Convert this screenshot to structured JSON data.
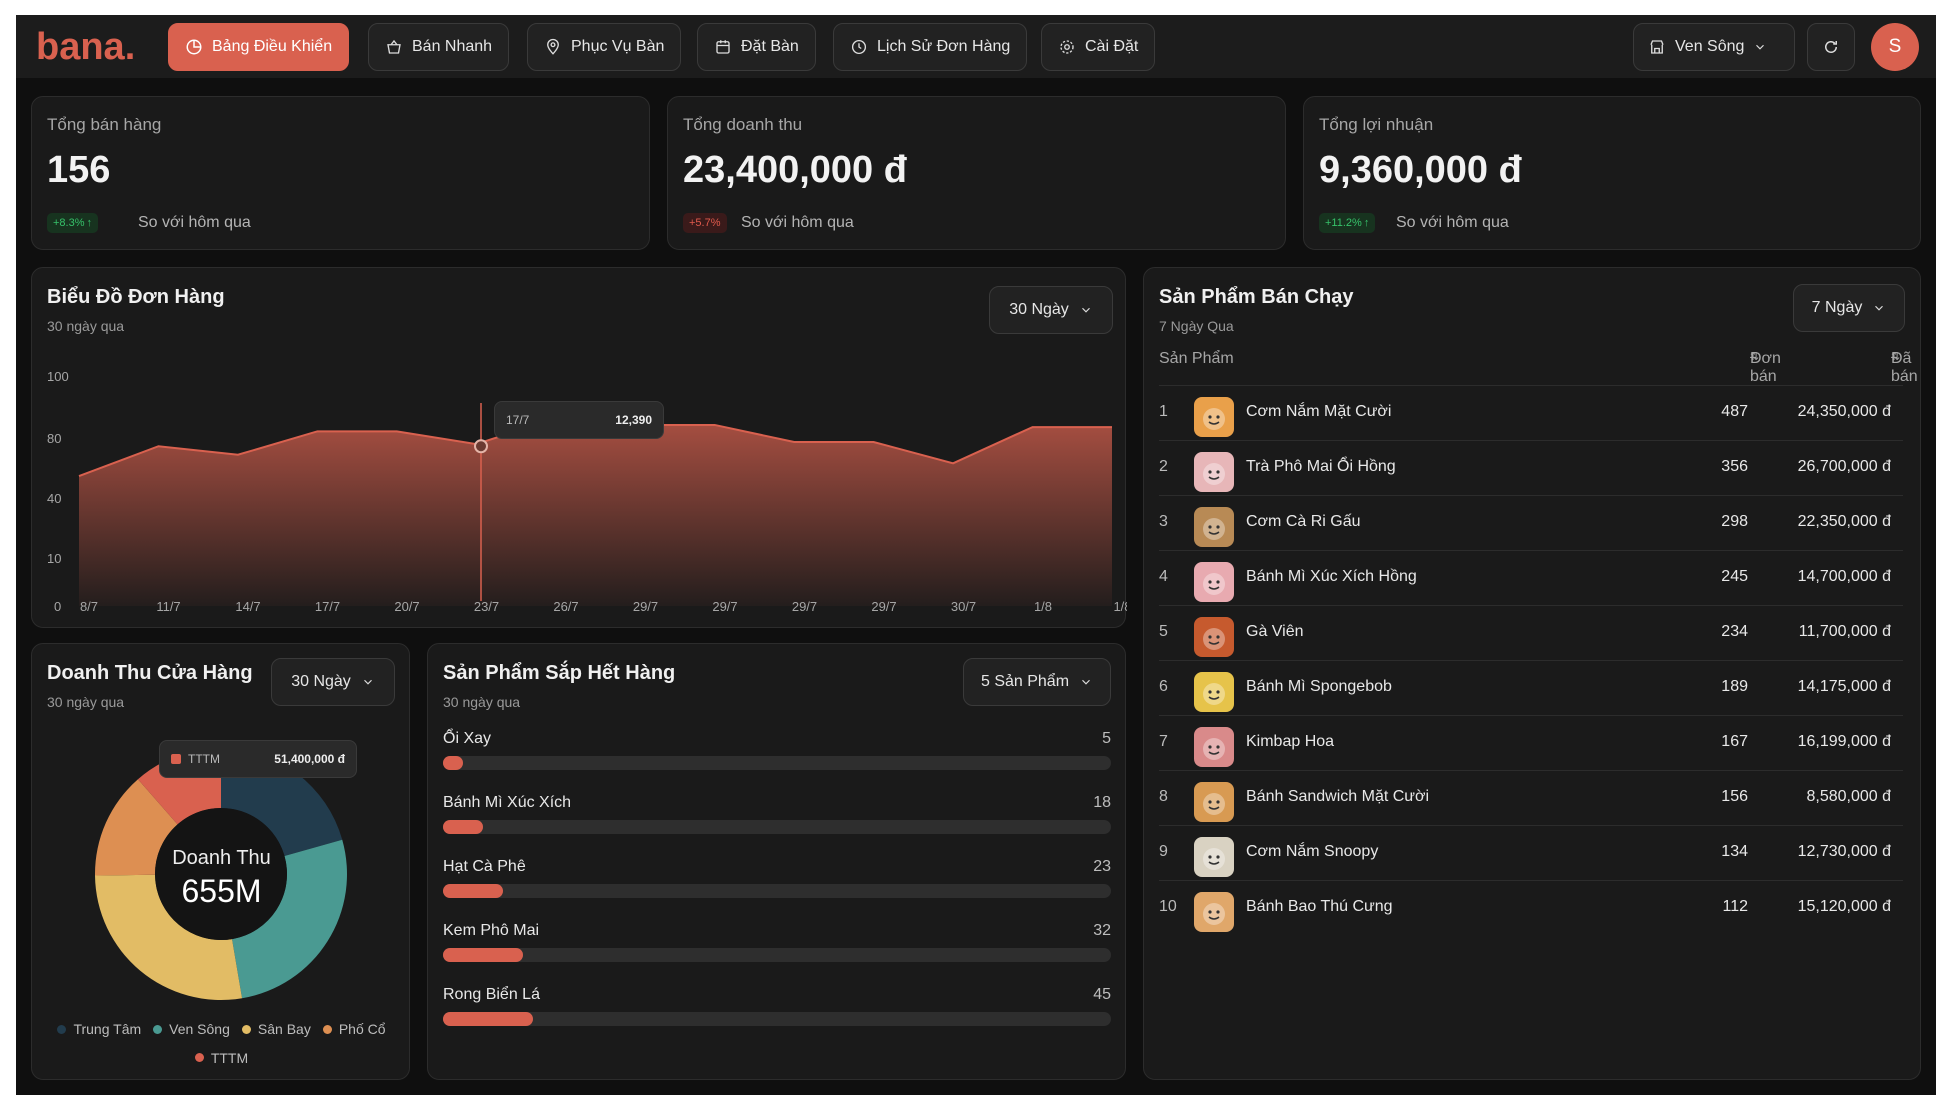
{
  "brand": {
    "logo_text": "bana."
  },
  "nav": {
    "items": [
      {
        "label": "Bảng Điều Khiển",
        "icon": "dashboard-icon",
        "active": true
      },
      {
        "label": "Bán Nhanh",
        "icon": "basket-icon",
        "active": false
      },
      {
        "label": "Phục Vụ Bàn",
        "icon": "location-icon",
        "active": false
      },
      {
        "label": "Đặt Bàn",
        "icon": "calendar-icon",
        "active": false
      },
      {
        "label": "Lịch Sử Đơn Hàng",
        "icon": "history-icon",
        "active": false
      },
      {
        "label": "Cài Đặt",
        "icon": "gear-icon",
        "active": false
      }
    ],
    "store": "Ven Sông",
    "avatar_initial": "S"
  },
  "kpis": [
    {
      "title": "Tổng bán hàng",
      "value": "156",
      "change": "+8.3%",
      "direction": "up",
      "compare": "So với hôm qua"
    },
    {
      "title": "Tổng doanh thu",
      "value": "23,400,000 đ",
      "change": "+5.7%",
      "direction": "down",
      "compare": "So với hôm qua"
    },
    {
      "title": "Tổng lợi nhuận",
      "value": "9,360,000 đ",
      "change": "+11.2%",
      "direction": "up",
      "compare": "So với hôm qua"
    }
  ],
  "orders_chart": {
    "title": "Biểu Đồ Đơn Hàng",
    "subtitle": "30 ngày qua",
    "range": "30 Ngày",
    "tooltip": {
      "date": "17/7",
      "value": "12,390"
    }
  },
  "revenue": {
    "title": "Doanh Thu Cửa Hàng",
    "subtitle": "30 ngày qua",
    "range": "30 Ngày",
    "center_label": "Doanh Thu",
    "center_value": "655M",
    "tooltip": {
      "name": "TTTM",
      "value": "51,400,000 đ"
    }
  },
  "low_stock": {
    "title": "Sản Phẩm Sắp Hết Hàng",
    "subtitle": "30 ngày qua",
    "range": "5 Sản Phẩm",
    "items": [
      {
        "name": "Ổi Xay",
        "qty": "5",
        "fraction": 0.03
      },
      {
        "name": "Bánh Mì Xúc Xích",
        "qty": "18",
        "fraction": 0.06
      },
      {
        "name": "Hạt Cà Phê",
        "qty": "23",
        "fraction": 0.09
      },
      {
        "name": "Kem Phô Mai",
        "qty": "32",
        "fraction": 0.12
      },
      {
        "name": "Rong Biển Lá",
        "qty": "45",
        "fraction": 0.135
      }
    ]
  },
  "best_sellers": {
    "title": "Sản Phẩm Bán Chạy",
    "subtitle": "7 Ngày Qua",
    "range": "7 Ngày",
    "columns": {
      "product": "Sản Phẩm",
      "orders": "Đơn bán",
      "sold": "Đã bán"
    },
    "rows": [
      {
        "rank": "1",
        "name": "Cơm Nắm Mặt Cười",
        "orders": "487",
        "sold": "24,350,000 đ",
        "color": "#e9a04a"
      },
      {
        "rank": "2",
        "name": "Trà Phô Mai Ổi Hồng",
        "orders": "356",
        "sold": "26,700,000 đ",
        "color": "#e7b6b8"
      },
      {
        "rank": "3",
        "name": "Cơm Cà Ri Gấu",
        "orders": "298",
        "sold": "22,350,000 đ",
        "color": "#b88a55"
      },
      {
        "rank": "4",
        "name": "Bánh Mì Xúc Xích Hồng",
        "orders": "245",
        "sold": "14,700,000 đ",
        "color": "#e8aab0"
      },
      {
        "rank": "5",
        "name": "Gà Viên",
        "orders": "234",
        "sold": "11,700,000 đ",
        "color": "#c65a2e"
      },
      {
        "rank": "6",
        "name": "Bánh Mì Spongebob",
        "orders": "189",
        "sold": "14,175,000 đ",
        "color": "#e6c34a"
      },
      {
        "rank": "7",
        "name": "Kimbap Hoa",
        "orders": "167",
        "sold": "16,199,000 đ",
        "color": "#d98a8a"
      },
      {
        "rank": "8",
        "name": "Bánh Sandwich Mặt Cười",
        "orders": "156",
        "sold": "8,580,000 đ",
        "color": "#d89a52"
      },
      {
        "rank": "9",
        "name": "Cơm Nắm Snoopy",
        "orders": "134",
        "sold": "12,730,000 đ",
        "color": "#d9d2c2"
      },
      {
        "rank": "10",
        "name": "Bánh Bao Thú Cưng",
        "orders": "112",
        "sold": "15,120,000 đ",
        "color": "#e0a76a"
      }
    ]
  },
  "chart_data": [
    {
      "type": "area",
      "title": "Biểu Đồ Đơn Hàng",
      "subtitle": "30 ngày qua",
      "x": [
        "8/7",
        "11/7",
        "14/7",
        "17/7",
        "20/7",
        "23/7",
        "26/7",
        "29/7",
        "29/7",
        "29/7",
        "29/7",
        "30/7",
        "1/8",
        "1/8"
      ],
      "y_ticks": [
        "0",
        "10",
        "40",
        "80",
        "100"
      ],
      "values": [
        61,
        75,
        71,
        82,
        82,
        76,
        88,
        85,
        85,
        77,
        77,
        67,
        84,
        84
      ],
      "color": "#d9614f"
    },
    {
      "type": "pie",
      "title": "Doanh Thu Cửa Hàng",
      "total_label": "655M",
      "slices": [
        {
          "name": "Trung Tâm",
          "value": 135,
          "color": "#223c4d"
        },
        {
          "name": "Ven Sông",
          "value": 175,
          "color": "#4a9a92"
        },
        {
          "name": "Sân Bay",
          "value": 180,
          "color": "#e2bc65"
        },
        {
          "name": "Phố Cổ",
          "value": 90,
          "color": "#dd8f52"
        },
        {
          "name": "TTTM",
          "value": 75,
          "color": "#d9614f"
        }
      ]
    }
  ]
}
